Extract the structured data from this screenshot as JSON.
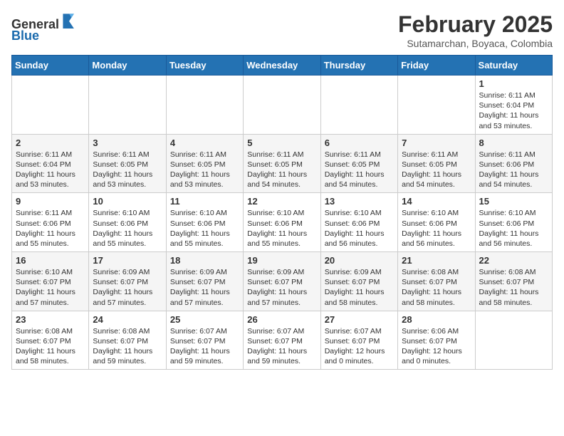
{
  "header": {
    "logo_line1": "General",
    "logo_line2": "Blue",
    "month_year": "February 2025",
    "subtitle": "Sutamarchan, Boyaca, Colombia"
  },
  "days_of_week": [
    "Sunday",
    "Monday",
    "Tuesday",
    "Wednesday",
    "Thursday",
    "Friday",
    "Saturday"
  ],
  "weeks": [
    [
      {
        "day": "",
        "info": ""
      },
      {
        "day": "",
        "info": ""
      },
      {
        "day": "",
        "info": ""
      },
      {
        "day": "",
        "info": ""
      },
      {
        "day": "",
        "info": ""
      },
      {
        "day": "",
        "info": ""
      },
      {
        "day": "1",
        "info": "Sunrise: 6:11 AM\nSunset: 6:04 PM\nDaylight: 11 hours\nand 53 minutes."
      }
    ],
    [
      {
        "day": "2",
        "info": "Sunrise: 6:11 AM\nSunset: 6:04 PM\nDaylight: 11 hours\nand 53 minutes."
      },
      {
        "day": "3",
        "info": "Sunrise: 6:11 AM\nSunset: 6:05 PM\nDaylight: 11 hours\nand 53 minutes."
      },
      {
        "day": "4",
        "info": "Sunrise: 6:11 AM\nSunset: 6:05 PM\nDaylight: 11 hours\nand 53 minutes."
      },
      {
        "day": "5",
        "info": "Sunrise: 6:11 AM\nSunset: 6:05 PM\nDaylight: 11 hours\nand 54 minutes."
      },
      {
        "day": "6",
        "info": "Sunrise: 6:11 AM\nSunset: 6:05 PM\nDaylight: 11 hours\nand 54 minutes."
      },
      {
        "day": "7",
        "info": "Sunrise: 6:11 AM\nSunset: 6:05 PM\nDaylight: 11 hours\nand 54 minutes."
      },
      {
        "day": "8",
        "info": "Sunrise: 6:11 AM\nSunset: 6:06 PM\nDaylight: 11 hours\nand 54 minutes."
      }
    ],
    [
      {
        "day": "9",
        "info": "Sunrise: 6:11 AM\nSunset: 6:06 PM\nDaylight: 11 hours\nand 55 minutes."
      },
      {
        "day": "10",
        "info": "Sunrise: 6:10 AM\nSunset: 6:06 PM\nDaylight: 11 hours\nand 55 minutes."
      },
      {
        "day": "11",
        "info": "Sunrise: 6:10 AM\nSunset: 6:06 PM\nDaylight: 11 hours\nand 55 minutes."
      },
      {
        "day": "12",
        "info": "Sunrise: 6:10 AM\nSunset: 6:06 PM\nDaylight: 11 hours\nand 55 minutes."
      },
      {
        "day": "13",
        "info": "Sunrise: 6:10 AM\nSunset: 6:06 PM\nDaylight: 11 hours\nand 56 minutes."
      },
      {
        "day": "14",
        "info": "Sunrise: 6:10 AM\nSunset: 6:06 PM\nDaylight: 11 hours\nand 56 minutes."
      },
      {
        "day": "15",
        "info": "Sunrise: 6:10 AM\nSunset: 6:06 PM\nDaylight: 11 hours\nand 56 minutes."
      }
    ],
    [
      {
        "day": "16",
        "info": "Sunrise: 6:10 AM\nSunset: 6:07 PM\nDaylight: 11 hours\nand 57 minutes."
      },
      {
        "day": "17",
        "info": "Sunrise: 6:09 AM\nSunset: 6:07 PM\nDaylight: 11 hours\nand 57 minutes."
      },
      {
        "day": "18",
        "info": "Sunrise: 6:09 AM\nSunset: 6:07 PM\nDaylight: 11 hours\nand 57 minutes."
      },
      {
        "day": "19",
        "info": "Sunrise: 6:09 AM\nSunset: 6:07 PM\nDaylight: 11 hours\nand 57 minutes."
      },
      {
        "day": "20",
        "info": "Sunrise: 6:09 AM\nSunset: 6:07 PM\nDaylight: 11 hours\nand 58 minutes."
      },
      {
        "day": "21",
        "info": "Sunrise: 6:08 AM\nSunset: 6:07 PM\nDaylight: 11 hours\nand 58 minutes."
      },
      {
        "day": "22",
        "info": "Sunrise: 6:08 AM\nSunset: 6:07 PM\nDaylight: 11 hours\nand 58 minutes."
      }
    ],
    [
      {
        "day": "23",
        "info": "Sunrise: 6:08 AM\nSunset: 6:07 PM\nDaylight: 11 hours\nand 58 minutes."
      },
      {
        "day": "24",
        "info": "Sunrise: 6:08 AM\nSunset: 6:07 PM\nDaylight: 11 hours\nand 59 minutes."
      },
      {
        "day": "25",
        "info": "Sunrise: 6:07 AM\nSunset: 6:07 PM\nDaylight: 11 hours\nand 59 minutes."
      },
      {
        "day": "26",
        "info": "Sunrise: 6:07 AM\nSunset: 6:07 PM\nDaylight: 11 hours\nand 59 minutes."
      },
      {
        "day": "27",
        "info": "Sunrise: 6:07 AM\nSunset: 6:07 PM\nDaylight: 12 hours\nand 0 minutes."
      },
      {
        "day": "28",
        "info": "Sunrise: 6:06 AM\nSunset: 6:07 PM\nDaylight: 12 hours\nand 0 minutes."
      },
      {
        "day": "",
        "info": ""
      }
    ]
  ]
}
